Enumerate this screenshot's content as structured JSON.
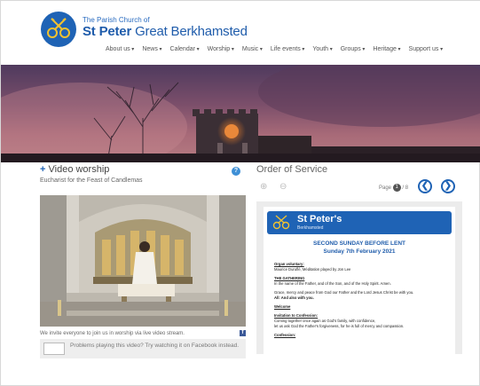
{
  "site": {
    "subtitle": "The Parish Church of",
    "title_bold": "St Peter",
    "title_light": "Great Berkhamsted"
  },
  "nav": {
    "items": [
      {
        "label": "About us"
      },
      {
        "label": "News"
      },
      {
        "label": "Calendar"
      },
      {
        "label": "Worship"
      },
      {
        "label": "Music"
      },
      {
        "label": "Life events"
      },
      {
        "label": "Youth"
      },
      {
        "label": "Groups"
      },
      {
        "label": "Heritage"
      },
      {
        "label": "Support us"
      }
    ]
  },
  "video_panel": {
    "plus": "+",
    "title": "Video worship",
    "help": "?",
    "subtitle": "Eucharist for the Feast of Candlemas",
    "invite": "We invite everyone to join us in worship via live video stream.",
    "fb": "f",
    "problem_text": "Problems playing this video? Try watching it on Facebook instead."
  },
  "order_of_service": {
    "title": "Order of Service",
    "zoom_in": "⊕",
    "zoom_out": "⊖",
    "page_label": "Page",
    "page_current": "1",
    "page_total": "/ 8",
    "prev": "❮",
    "next": "❯",
    "doc": {
      "brand": "St Peter's",
      "brand_sub": "Berkhamsted",
      "heading1": "SECOND SUNDAY BEFORE LENT",
      "heading2": "Sunday 7th February 2021",
      "lines": [
        {
          "text": "Organ voluntary:",
          "style": "u"
        },
        {
          "text": "Maurice Duruflé, Méditation played by Jon Lee",
          "style": ""
        },
        {
          "text": "THE GATHERING",
          "style": "u"
        },
        {
          "text": "In the name of the Father, and of the Son, and of the Holy Spirit.  Amen.",
          "style": ""
        },
        {
          "text": "Grace, mercy and peace from God our Father and the Lord Jesus Christ be with you.",
          "style": ""
        },
        {
          "text": "All: And also with you.",
          "style": "b"
        },
        {
          "text": "Welcome",
          "style": "u"
        },
        {
          "text": "Invitation to Confession:",
          "style": "u"
        },
        {
          "text": "Coming together once again as God's family, with confidence,",
          "style": ""
        },
        {
          "text": "let us ask God the Father's forgiveness, for he is full of mercy and compassion.",
          "style": ""
        },
        {
          "text": "Confession:",
          "style": "u"
        }
      ]
    }
  },
  "colors": {
    "brand_blue": "#1f63b5",
    "sky_purple": "#7a4e6a",
    "sky_pink": "#b67c82"
  }
}
